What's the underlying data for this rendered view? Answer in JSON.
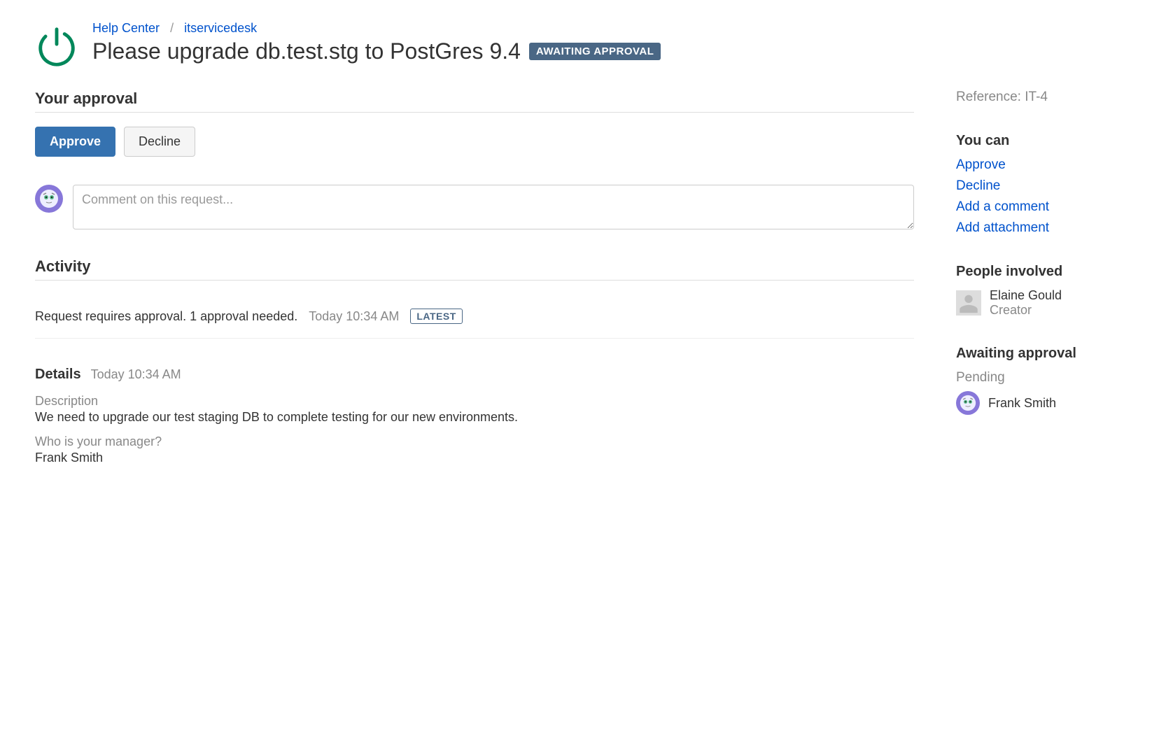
{
  "breadcrumb": {
    "help_center": "Help Center",
    "project": "itservicedesk"
  },
  "title": "Please upgrade db.test.stg to PostGres 9.4",
  "status_badge": "AWAITING APPROVAL",
  "approval": {
    "heading": "Your approval",
    "approve_label": "Approve",
    "decline_label": "Decline"
  },
  "comment": {
    "placeholder": "Comment on this request..."
  },
  "activity": {
    "heading": "Activity",
    "entry": {
      "message": "Request requires approval. 1 approval needed.",
      "time": "Today 10:34 AM",
      "latest_label": "LATEST"
    }
  },
  "details": {
    "heading": "Details",
    "time": "Today 10:34 AM",
    "description_label": "Description",
    "description_value": "We need to upgrade our test staging DB to complete testing for our new environments.",
    "manager_label": "Who is your manager?",
    "manager_value": "Frank Smith"
  },
  "sidebar": {
    "reference_label": "Reference:",
    "reference_value": "IT-4",
    "you_can_heading": "You can",
    "links": {
      "approve": "Approve",
      "decline": "Decline",
      "add_comment": "Add a comment",
      "add_attachment": "Add attachment"
    },
    "people_heading": "People involved",
    "people": {
      "creator_name": "Elaine Gould",
      "creator_role": "Creator"
    },
    "awaiting_heading": "Awaiting approval",
    "awaiting_status": "Pending",
    "awaiting_person": "Frank Smith"
  }
}
